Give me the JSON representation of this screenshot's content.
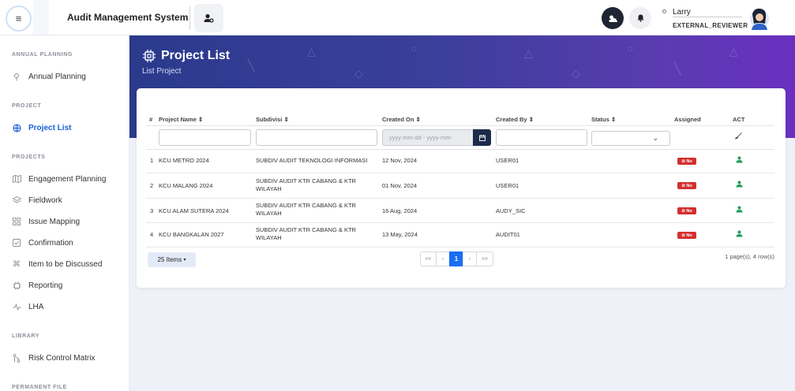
{
  "header": {
    "app_title": "Audit Management System",
    "user_name": "Larry",
    "user_role": "EXTERNAL_REVIEWER"
  },
  "sidebar": {
    "sections": [
      {
        "label": "ANNUAL PLANNING",
        "items": [
          {
            "label": "Annual Planning",
            "icon": "compass-icon"
          }
        ]
      },
      {
        "label": "PROJECT",
        "items": [
          {
            "label": "Project List",
            "icon": "globe-icon",
            "active": true
          }
        ]
      },
      {
        "label": "PROJECTS",
        "items": [
          {
            "label": "Engagement Planning",
            "icon": "map-icon"
          },
          {
            "label": "Fieldwork",
            "icon": "layers-icon"
          },
          {
            "label": "Issue Mapping",
            "icon": "grid-icon"
          },
          {
            "label": "Confirmation",
            "icon": "check-square-icon"
          },
          {
            "label": "Item to be Discussed",
            "icon": "command-icon"
          },
          {
            "label": "Reporting",
            "icon": "chip-icon"
          },
          {
            "label": "LHA",
            "icon": "activity-icon"
          }
        ]
      },
      {
        "label": "LIBRARY",
        "items": [
          {
            "label": "Risk Control Matrix",
            "icon": "git-icon"
          }
        ]
      },
      {
        "label": "PERMANENT FILE",
        "items": []
      }
    ]
  },
  "page": {
    "title": "Project List",
    "subtitle": "List Project"
  },
  "table": {
    "columns": {
      "num": "#",
      "project_name": "Project Name",
      "subdivisi": "Subdivisi",
      "created_on": "Created On",
      "created_by": "Created By",
      "status": "Status",
      "assigned": "Assigned",
      "act": "ACT"
    },
    "date_placeholder": "yyyy-mm-dd - yyyy-mm-",
    "rows": [
      {
        "num": "1",
        "project_name": "KCU METRO 2024",
        "subdivisi": "SUBDIV AUDIT TEKNOLOGI INFORMASI",
        "created_on": "12 Nov, 2024",
        "created_by": "USER01",
        "assigned": "No"
      },
      {
        "num": "2",
        "project_name": "KCU MALANG 2024",
        "subdivisi": "SUBDIV AUDIT KTR CABANG & KTR WILAYAH",
        "created_on": "01 Nov, 2024",
        "created_by": "USER01",
        "assigned": "No"
      },
      {
        "num": "3",
        "project_name": "KCU ALAM SUTERA 2024",
        "subdivisi": "SUBDIV AUDIT KTR CABANG & KTR WILAYAH",
        "created_on": "16 Aug, 2024",
        "created_by": "AUDY_SIC",
        "assigned": "No"
      },
      {
        "num": "4",
        "project_name": "KCU BANGKALAN 2027",
        "subdivisi": "SUBDIV AUDIT KTR CABANG & KTR WILAYAH",
        "created_on": "13 May, 2024",
        "created_by": "AUDIT01",
        "assigned": "No"
      }
    ]
  },
  "footer": {
    "items_per_page": "25 Items",
    "pager": {
      "first": "««",
      "prev": "‹",
      "current": "1",
      "next": "›",
      "last": "»»"
    },
    "page_info": "1 page(s), 4 row(s)"
  }
}
